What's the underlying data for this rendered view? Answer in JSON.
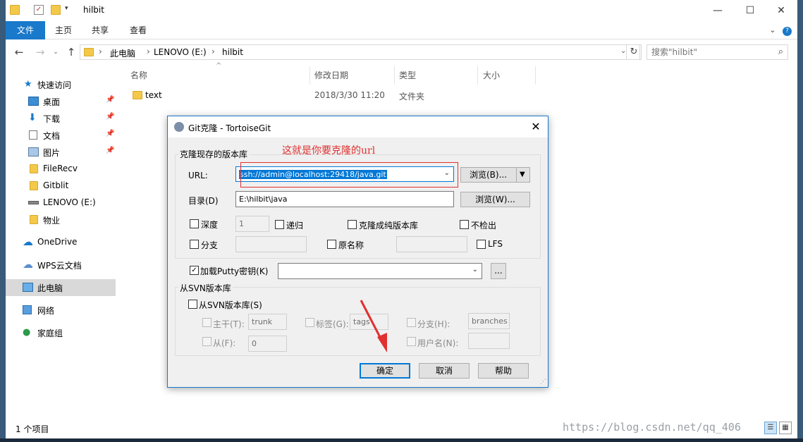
{
  "window": {
    "title": "hilbit",
    "controls": {
      "minimize": "—",
      "maximize": "☐",
      "close": "✕"
    }
  },
  "ribbon": {
    "tabs": [
      "文件",
      "主页",
      "共享",
      "查看"
    ],
    "right_icons": [
      "chevron-down-icon",
      "help-icon"
    ]
  },
  "address": {
    "crumbs": [
      "此电脑",
      "LENOVO (E:)",
      "hilbit"
    ],
    "search_placeholder": "搜索\"hilbit\""
  },
  "sidebar": {
    "items": [
      {
        "label": "快速访问",
        "icon": "star-icon"
      },
      {
        "label": "桌面",
        "icon": "desktop-icon",
        "pinned": true
      },
      {
        "label": "下载",
        "icon": "download-icon",
        "pinned": true
      },
      {
        "label": "文档",
        "icon": "document-icon",
        "pinned": true
      },
      {
        "label": "图片",
        "icon": "picture-icon",
        "pinned": true
      },
      {
        "label": "FileRecv",
        "icon": "folder-icon"
      },
      {
        "label": "Gitblit",
        "icon": "folder-icon"
      },
      {
        "label": "LENOVO (E:)",
        "icon": "drive-icon"
      },
      {
        "label": "物业",
        "icon": "folder-icon"
      },
      {
        "label": "OneDrive",
        "icon": "cloud-icon"
      },
      {
        "label": "WPS云文档",
        "icon": "cloud-outline-icon"
      },
      {
        "label": "此电脑",
        "icon": "computer-icon",
        "selected": true
      },
      {
        "label": "网络",
        "icon": "network-icon"
      },
      {
        "label": "家庭组",
        "icon": "homegroup-icon"
      }
    ]
  },
  "filelist": {
    "columns": [
      "名称",
      "修改日期",
      "类型",
      "大小"
    ],
    "rows": [
      {
        "name": "text",
        "modified": "2018/3/30 11:20",
        "type": "文件夹",
        "size": ""
      }
    ]
  },
  "status": {
    "count": "1 个项目",
    "watermark": "https://blog.csdn.net/qq_406"
  },
  "dialog": {
    "title": "Git克隆 - TortoiseGit",
    "group_repo": "克隆现存的版本库",
    "url_label": "URL:",
    "url_value": "ssh://admin@localhost:29418/java.git",
    "browse_url_button": "浏览(B)...",
    "dir_label": "目录(D)",
    "dir_value": "E:\\hilbit\\java",
    "browse_dir_button": "浏览(W)...",
    "depth_label": "深度",
    "depth_value": "1",
    "recursive_label": "递归",
    "bare_label": "克隆成纯版本库",
    "no_checkout_label": "不检出",
    "branch_label": "分支",
    "origin_label": "原名称",
    "lfs_label": "LFS",
    "putty_label": "加载Putty密钥(K)",
    "putty_checked": true,
    "putty_value": "",
    "putty_browse": "...",
    "group_svn": "从SVN版本库",
    "svn_checkbox": "从SVN版本库(S)",
    "trunk_label": "主干(T):",
    "trunk_value": "trunk",
    "tags_label": "标签(G):",
    "tags_value": "tags",
    "branches_label": "分支(H):",
    "branches_value": "branches",
    "from_label": "从(F):",
    "from_value": "0",
    "username_label": "用户名(N):",
    "ok_button": "确定",
    "cancel_button": "取消",
    "help_button": "帮助"
  },
  "annotation": {
    "text": "这就是你要克隆的url",
    "color": "#e03030"
  },
  "colors": {
    "accent": "#1979ca",
    "selection": "#0078d7",
    "folder": "#f4c94a"
  }
}
